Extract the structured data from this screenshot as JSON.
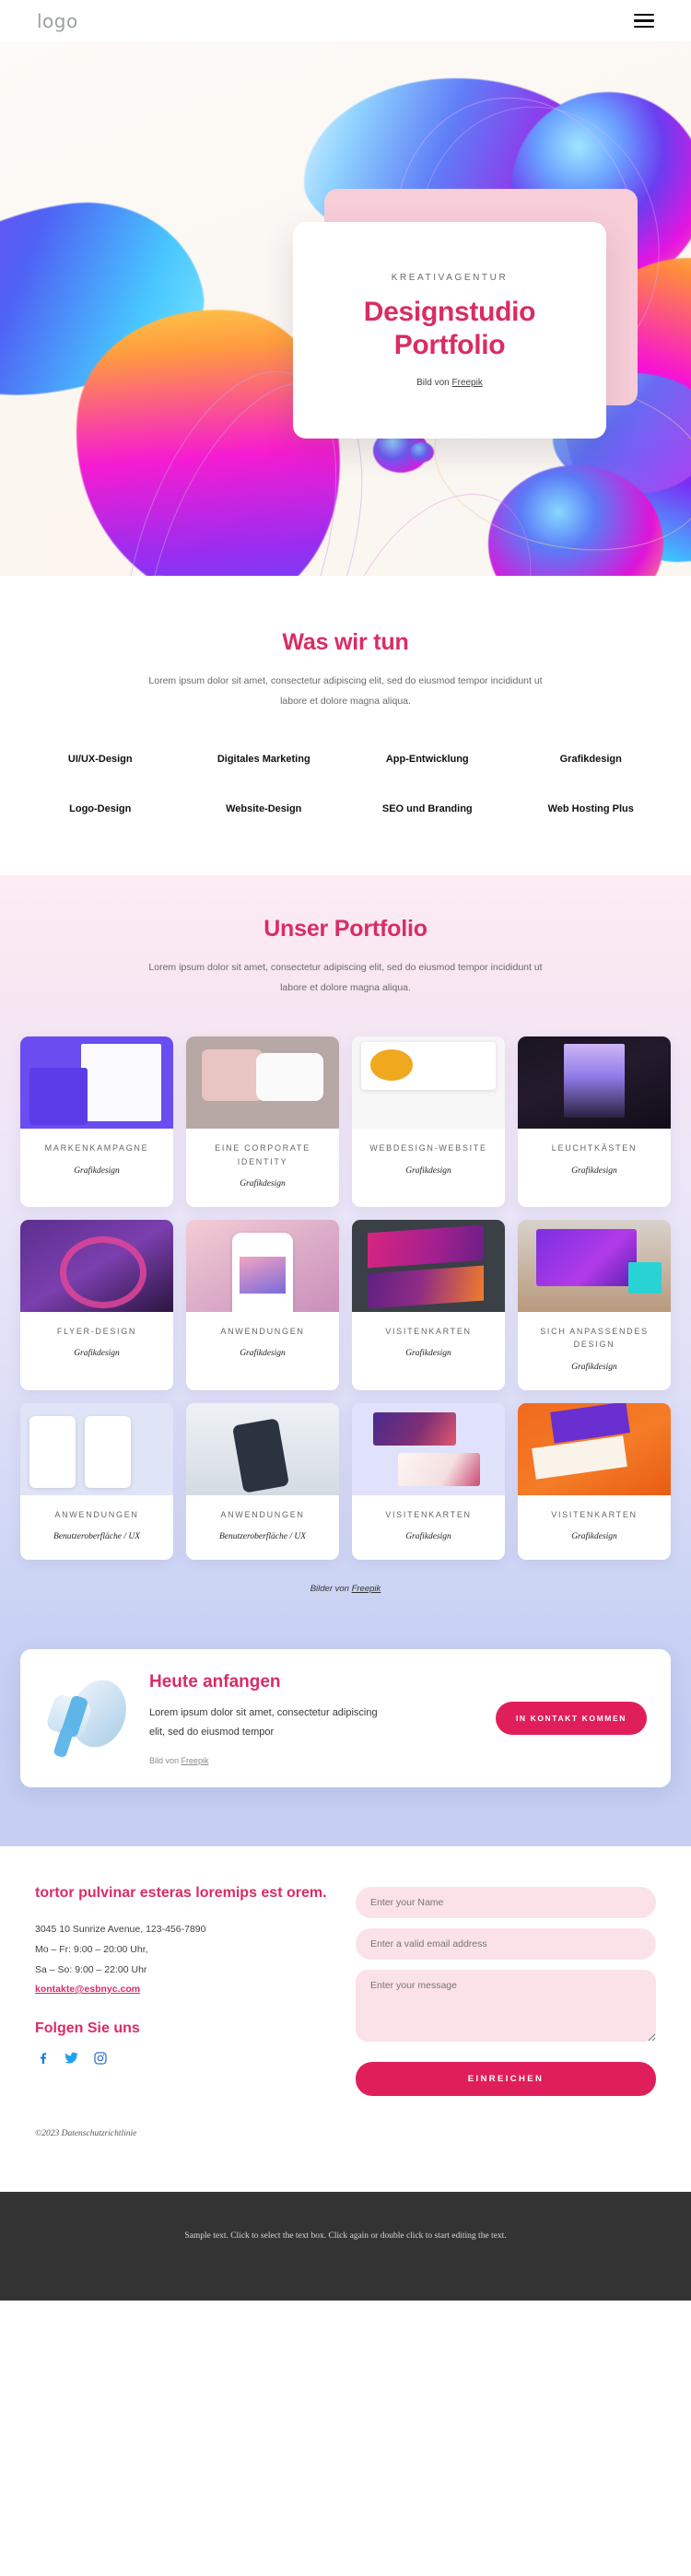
{
  "header": {
    "logo": "logo",
    "menu_icon": "hamburger-menu-icon"
  },
  "hero": {
    "eyebrow": "KREATIVAGENTUR",
    "title_line1": "Designstudio",
    "title_line2": "Portfolio",
    "credit_prefix": "Bild von ",
    "credit_link": "Freepik"
  },
  "services": {
    "title": "Was wir tun",
    "subtitle": "Lorem ipsum dolor sit amet, consectetur adipiscing elit, sed do eiusmod tempor incididunt ut labore et dolore magna aliqua.",
    "items": [
      "UI/UX-Design",
      "Digitales Marketing",
      "App-Entwicklung",
      "Grafikdesign",
      "Logo-Design",
      "Website-Design",
      "SEO und Branding",
      "Web Hosting Plus"
    ]
  },
  "portfolio": {
    "title": "Unser Portfolio",
    "subtitle": "Lorem ipsum dolor sit amet, consectetur adipiscing elit, sed do eiusmod tempor incididunt ut labore et dolore magna aliqua.",
    "credit_prefix": "Bilder von ",
    "credit_link": "Freepik",
    "items": [
      {
        "name": "MARKENKAMPAGNE",
        "category": "Grafikdesign",
        "thumb": "t-brand"
      },
      {
        "name": "EINE CORPORATE IDENTITY",
        "category": "Grafikdesign",
        "thumb": "t-ci"
      },
      {
        "name": "WEBDESIGN-WEBSITE",
        "category": "Grafikdesign",
        "thumb": "t-web"
      },
      {
        "name": "LEUCHTKÄSTEN",
        "category": "Grafikdesign",
        "thumb": "t-light"
      },
      {
        "name": "FLYER-DESIGN",
        "category": "Grafikdesign",
        "thumb": "t-flyer"
      },
      {
        "name": "ANWENDUNGEN",
        "category": "Grafikdesign",
        "thumb": "t-apps1"
      },
      {
        "name": "VISITENKARTEN",
        "category": "Grafikdesign",
        "thumb": "t-cards1"
      },
      {
        "name": "SICH ANPASSENDES DESIGN",
        "category": "Grafikdesign",
        "thumb": "t-resp"
      },
      {
        "name": "ANWENDUNGEN",
        "category": "Benutzeroberfläche / UX",
        "thumb": "t-apps2"
      },
      {
        "name": "ANWENDUNGEN",
        "category": "Benutzeroberfläche / UX",
        "thumb": "t-apps3"
      },
      {
        "name": "VISITENKARTEN",
        "category": "Grafikdesign",
        "thumb": "t-cards2"
      },
      {
        "name": "VISITENKARTEN",
        "category": "Grafikdesign",
        "thumb": "t-cards3"
      }
    ]
  },
  "cta": {
    "title": "Heute anfangen",
    "paragraph": "Lorem ipsum dolor sit amet, consectetur adipiscing elit, sed do eiusmod tempor",
    "credit_prefix": "Bild von ",
    "credit_link": "Freepik",
    "button": "IN KONTAKT KOMMEN",
    "image_name": "megaphone-illustration"
  },
  "contact": {
    "heading": "tortor pulvinar esteras loremips est orem.",
    "address": "3045 10 Sunrize Avenue, 123-456-7890",
    "hours_1": "Mo – Fr: 9:00 – 20:00 Uhr,",
    "hours_2": "Sa – So: 9:00 – 22:00 Uhr",
    "email": "kontakte@esbnyc.com",
    "follow_heading": "Folgen Sie uns",
    "socials": [
      "facebook-icon",
      "twitter-icon",
      "instagram-icon"
    ],
    "form": {
      "name_placeholder": "Enter your Name",
      "email_placeholder": "Enter a valid email address",
      "message_placeholder": "Enter your message",
      "submit_label": "EINREICHEN"
    }
  },
  "footer": {
    "copyright": "©2023 Datenschutzrichtlinie",
    "sample_text": "Sample text. Click to select the text box. Click again or double click to start editing the text."
  },
  "colors": {
    "accent_pink": "#da2c63",
    "button_pink": "#e01e5a",
    "field_pink": "#fae2e8",
    "dark_bar": "#333333"
  }
}
